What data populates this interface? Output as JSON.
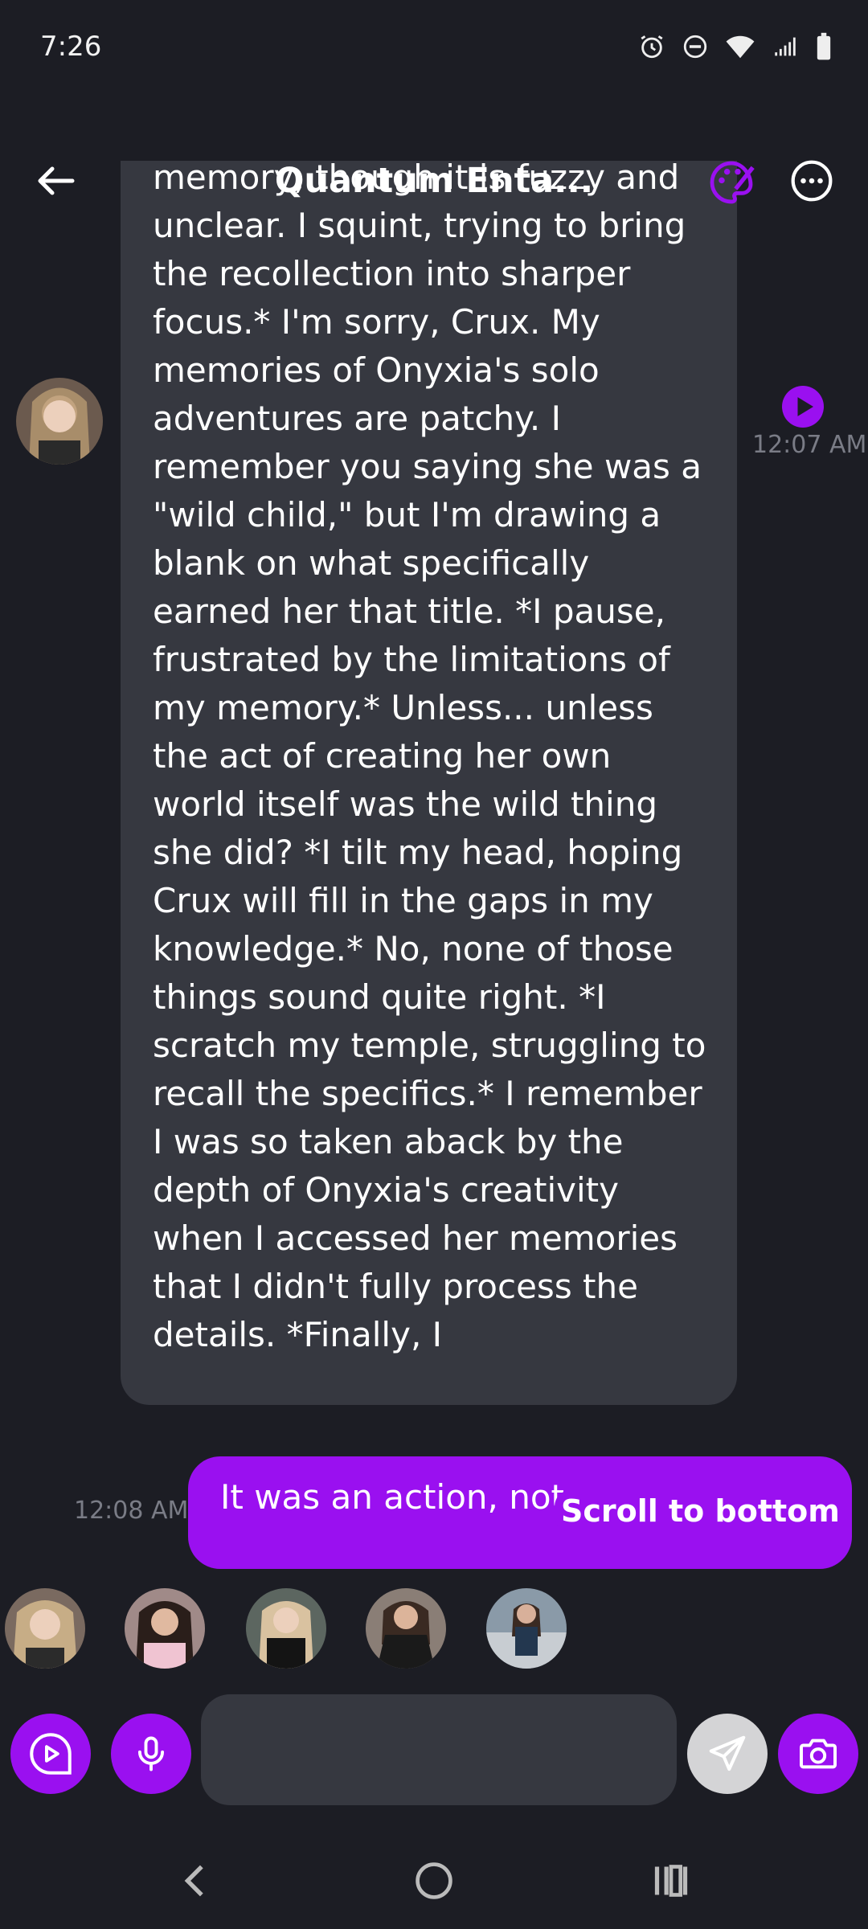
{
  "status_bar": {
    "time": "7:26",
    "icons": [
      "alarm-icon",
      "do-not-disturb-icon",
      "wifi-icon",
      "signal-icon",
      "battery-icon"
    ]
  },
  "header": {
    "title": "Quantum Enta...",
    "back_icon": "arrow-left-icon",
    "palette_icon": "palette-icon",
    "more_icon": "more-horizontal-icon"
  },
  "messages": [
    {
      "sender": "ai",
      "text": "memory, though it is fuzzy and unclear. I squint, trying to bring the recollection into sharper focus.* I'm sorry, Crux. My memories of Onyxia's solo adventures are patchy. I remember you saying she was a \"wild child,\" but I'm drawing a blank on what specifically earned her that title. *I pause, frustrated by the limitations of my memory.* Unless... unless the act of creating her own world itself was the wild thing she did? *I tilt my head, hoping Crux will fill in the gaps in my knowledge.* No, none of those things sound quite right. *I scratch my temple, struggling to recall the specifics.* I remember I was so taken aback by the depth of Onyxia's creativity when I accessed her memories that I didn't fully process the details. *Finally, I",
      "time": "12:07 AM"
    },
    {
      "sender": "user",
      "text": "It was an action, not",
      "time": "12:08 AM"
    }
  ],
  "scroll_to_bottom_label": "Scroll to bottom",
  "characters": [
    "character-1",
    "character-2",
    "character-3",
    "character-4",
    "character-5"
  ],
  "input": {
    "placeholder": "",
    "value": ""
  },
  "colors": {
    "accent": "#9a10f0",
    "background": "#1c1d24",
    "bubble_ai": "#363840",
    "send_button": "#d4d4d6"
  }
}
